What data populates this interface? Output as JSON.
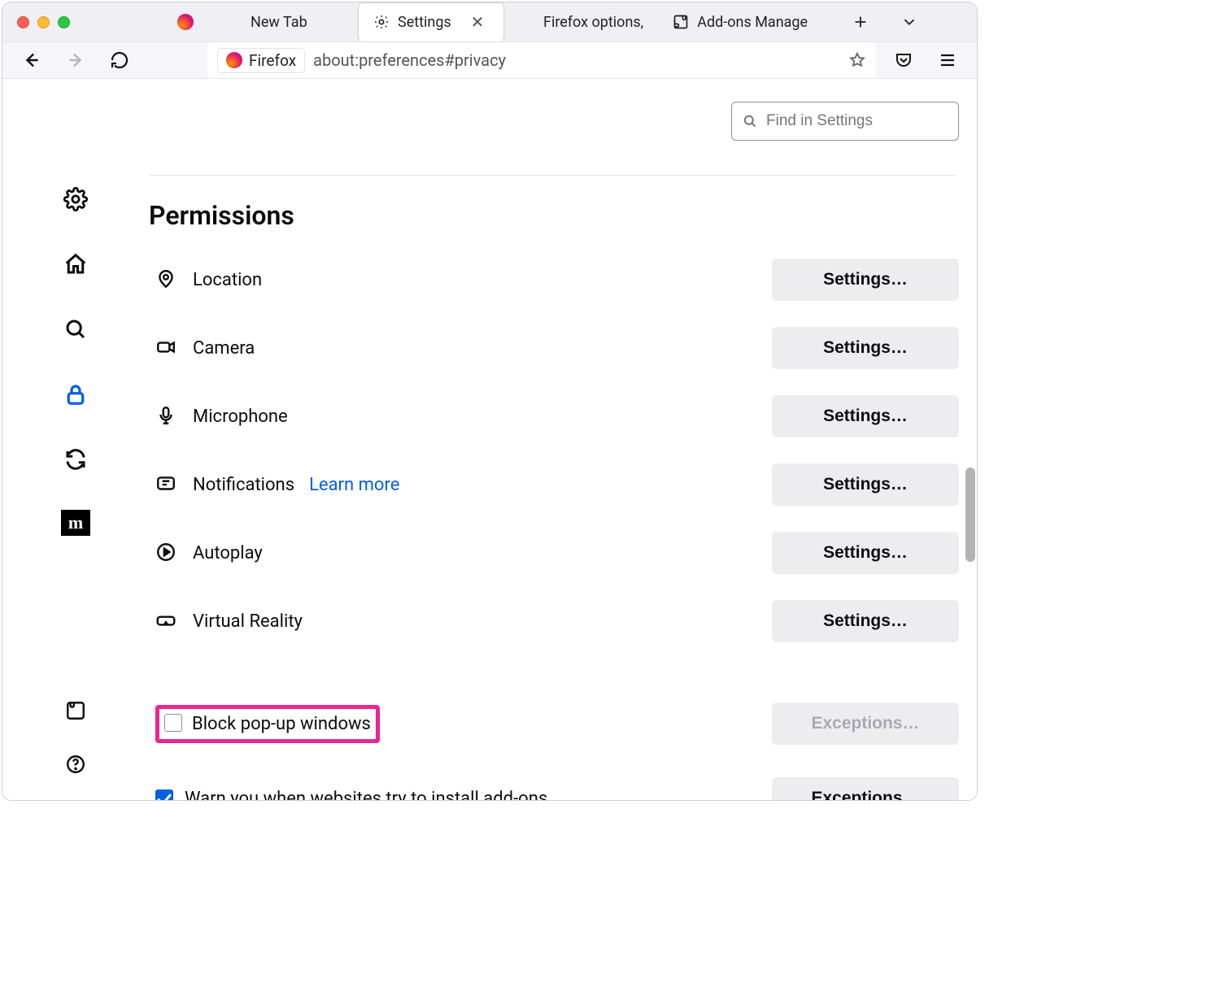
{
  "tabs": [
    {
      "label": "New Tab",
      "icon": "firefox"
    },
    {
      "label": "Settings",
      "icon": "gear",
      "active": true
    },
    {
      "label": "Firefox options,",
      "icon": "firefox"
    },
    {
      "label": "Add-ons Manage",
      "icon": "puzzle"
    }
  ],
  "urlbar": {
    "identity_label": "Firefox",
    "url": "about:preferences#privacy"
  },
  "search": {
    "placeholder": "Find in Settings"
  },
  "section": {
    "title": "Permissions"
  },
  "permissions": [
    {
      "key": "location",
      "label": "Location",
      "button": "Settings…"
    },
    {
      "key": "camera",
      "label": "Camera",
      "button": "Settings…"
    },
    {
      "key": "microphone",
      "label": "Microphone",
      "button": "Settings…"
    },
    {
      "key": "notifications",
      "label": "Notifications",
      "button": "Settings…",
      "learn_more": "Learn more"
    },
    {
      "key": "autoplay",
      "label": "Autoplay",
      "button": "Settings…"
    },
    {
      "key": "vr",
      "label": "Virtual Reality",
      "button": "Settings…"
    }
  ],
  "checkboxes": {
    "block_popups": {
      "label": "Block pop-up windows",
      "checked": false,
      "button": "Exceptions…",
      "button_disabled": true
    },
    "warn_addons": {
      "label": "Warn you when websites try to install add-ons",
      "checked": true,
      "button": "Exceptions…",
      "button_disabled": false
    }
  }
}
